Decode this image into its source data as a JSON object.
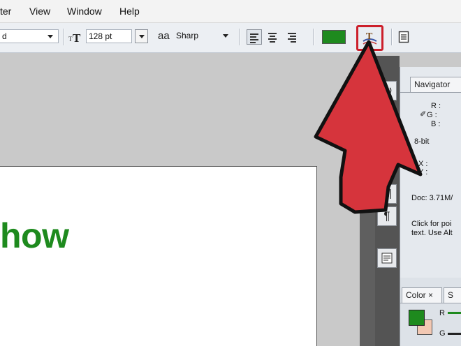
{
  "menubar": {
    "items": [
      "ter",
      "View",
      "Window",
      "Help"
    ]
  },
  "options_bar": {
    "font_style_value": "d",
    "font_size_value": "128 pt",
    "antialias_label": "aa",
    "antialias_value": "Sharp",
    "text_color": "#1e8a1e"
  },
  "document": {
    "visible_text": "how",
    "text_color": "#1e8a1e"
  },
  "tools": {
    "history_glyph": "⭮",
    "character_glyph": "A|",
    "paragraph_glyph": "¶"
  },
  "info_panel": {
    "tab_label": "Navigator",
    "r_label": "R :",
    "g_label": "G :",
    "b_label": "B :",
    "bit_depth": "8-bit",
    "x_label": "X :",
    "y_label": "Y :",
    "doc_size": "Doc: 3.71M/",
    "hint_line1": "Click for poi",
    "hint_line2": "text. Use Alt"
  },
  "color_panel": {
    "tab_label": "Color ×",
    "tab2_label": "S",
    "r_label": "R",
    "g_label": "G",
    "foreground": "#1e8a1e",
    "background": "#f2c8b3"
  },
  "highlight_color": "#cc1f2b",
  "arrow_color": "#d6343c"
}
